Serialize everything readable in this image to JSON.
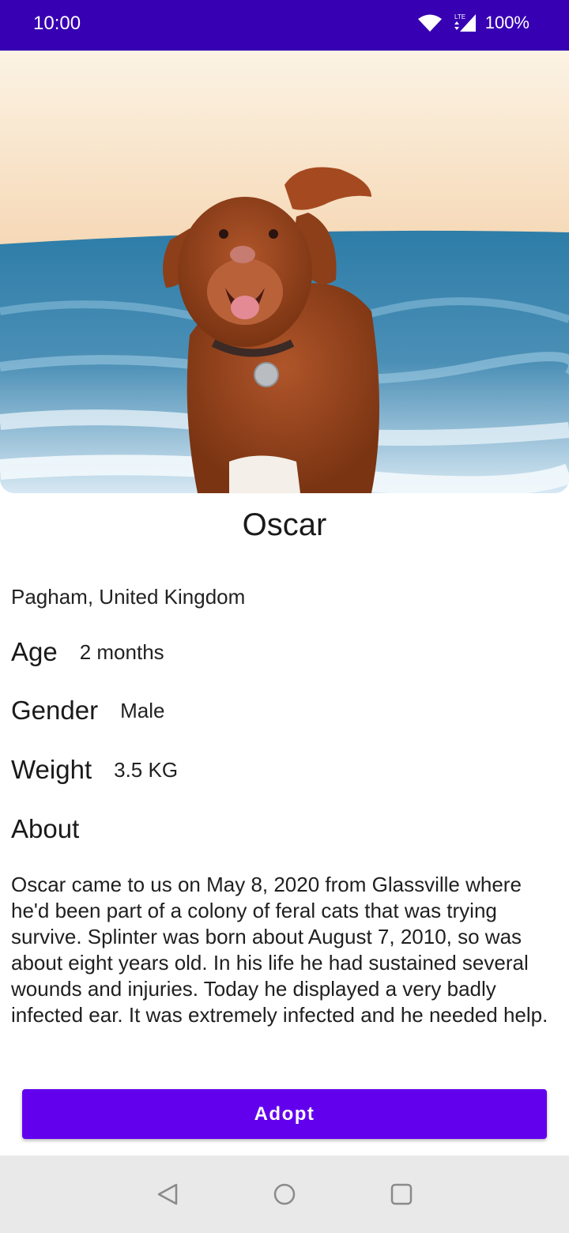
{
  "status_bar": {
    "time": "10:00",
    "battery": "100%",
    "icons": [
      "wifi-icon",
      "lte-signal-icon"
    ],
    "background": "#3700b3"
  },
  "hero_image": {
    "subject": "dog-photo-icon"
  },
  "pet": {
    "name": "Oscar",
    "location": "Pagham, United Kingdom",
    "age_label": "Age",
    "age_value": "2 months",
    "gender_label": "Gender",
    "gender_value": "Male",
    "weight_label": "Weight",
    "weight_value": "3.5 KG",
    "about_label": "About",
    "about_text": "Oscar came to us on May 8, 2020 from Glassville where he'd been part of a colony of feral cats that was trying survive. Splinter was born about August 7, 2010, so was about eight years old. In his life he had sustained several wounds and injuries. Today he displayed a very badly infected ear. It was extremely infected and he needed help."
  },
  "actions": {
    "adopt_label": "Adopt",
    "accent": "#6200ee"
  },
  "nav_bar": {
    "icons": [
      "back-icon",
      "home-icon",
      "recents-icon"
    ]
  }
}
